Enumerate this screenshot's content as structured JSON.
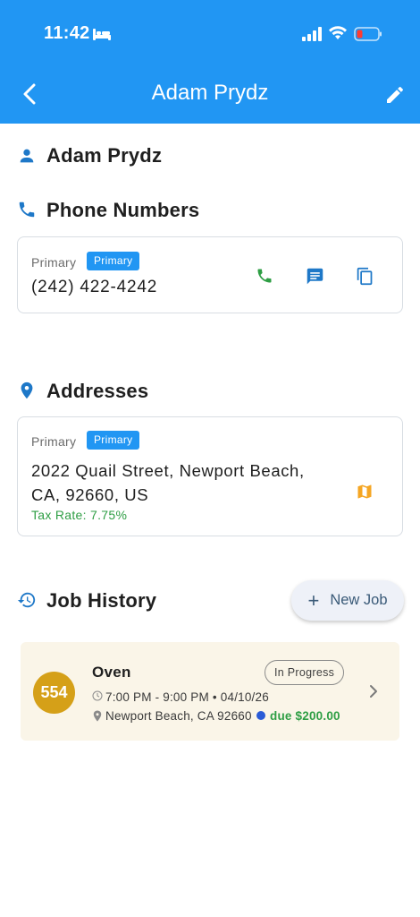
{
  "status_bar": {
    "time": "11:42"
  },
  "header": {
    "title": "Adam Prydz"
  },
  "customer": {
    "name": "Adam Prydz"
  },
  "phone_section": {
    "title": "Phone Numbers",
    "label": "Primary",
    "badge": "Primary",
    "number": "(242) 422-4242"
  },
  "address_section": {
    "title": "Addresses",
    "label": "Primary",
    "badge": "Primary",
    "line1": "2022 Quail Street, Newport Beach,",
    "line2": "CA, 92660, US",
    "tax": "Tax Rate: 7.75%"
  },
  "job_history": {
    "title": "Job History",
    "new_job_label": "New Job",
    "jobs": [
      {
        "number": "554",
        "title": "Oven",
        "status": "In Progress",
        "time": "7:00 PM - 9:00 PM • 04/10/26",
        "address": "Newport Beach, CA 92660",
        "due": "due $200.00"
      }
    ]
  },
  "colors": {
    "header_bg": "#2196f3",
    "badge_bg": "#2196f3",
    "call_green": "#2e9e44",
    "map_orange": "#f5a623",
    "job_number_bg": "#d5a018",
    "job_card_bg": "#faf5e8"
  },
  "icons": {
    "back": "back-arrow-icon",
    "edit": "pencil-icon",
    "person": "person-icon",
    "phone": "phone-icon",
    "location": "location-pin-icon",
    "history": "history-icon",
    "call": "call-icon",
    "message": "message-icon",
    "copy": "copy-icon",
    "map": "map-icon"
  }
}
